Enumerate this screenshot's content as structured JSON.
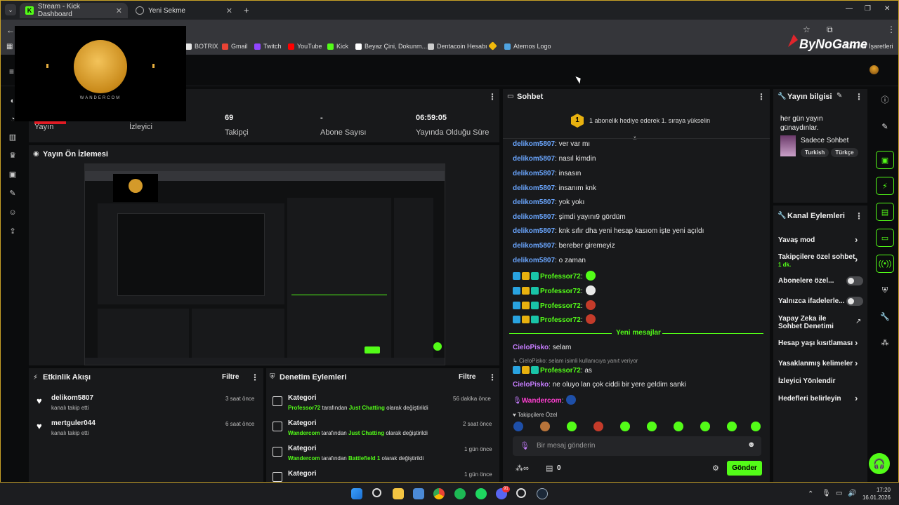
{
  "browser": {
    "tabs": [
      {
        "label": "Stream - Kick Dashboard",
        "active": true
      },
      {
        "label": "Yeni Sekme",
        "active": false
      }
    ],
    "new_tab_symbol": "+",
    "bookmarks": [
      {
        "label": "BOTRIX",
        "color": "#e6e6e6"
      },
      {
        "label": "Gmail",
        "color": "#ea4335"
      },
      {
        "label": "Twitch",
        "color": "#9146ff"
      },
      {
        "label": "YouTube",
        "color": "#ff0000"
      },
      {
        "label": "Kick",
        "color": "#53fc18"
      },
      {
        "label": "Beyaz Çini, Dokunm...",
        "color": "#ffffff"
      },
      {
        "label": "Dentacoin Hesabı",
        "color": "#cccccc"
      },
      {
        "label": "",
        "color": "#f0b90b"
      },
      {
        "label": "Aternos Logo",
        "color": "#4fa3e0"
      }
    ],
    "all_bookmarks": "Tüm Yer İşaretleri",
    "overlay_logo": "ByNoGame",
    "webcam_caption": "WANDERCOM"
  },
  "stats": [
    {
      "value": "",
      "label": "Yayın"
    },
    {
      "value": "",
      "label": "İzleyici"
    },
    {
      "value": "69",
      "label": "Takipçi"
    },
    {
      "value": "-",
      "label": "Abone Sayısı"
    },
    {
      "value": "06:59:05",
      "label": "Yayında Olduğu Süre"
    }
  ],
  "preview": {
    "title": "Yayın Ön İzlemesi"
  },
  "activity": {
    "title": "Etkinlik Akışı",
    "filter": "Filtre",
    "items": [
      {
        "user": "delikom5807",
        "action": "kanalı takip etti",
        "time": "3 saat önce"
      },
      {
        "user": "mertguler044",
        "action": "kanalı takip etti",
        "time": "6 saat önce"
      }
    ]
  },
  "moderation": {
    "title": "Denetim Eylemleri",
    "filter": "Filtre",
    "items": [
      {
        "title": "Kategori",
        "user": "Professor72",
        "mid": " tarafından ",
        "target": "Just Chatting",
        "tail": " olarak değiştirildi",
        "time": "56 dakika önce"
      },
      {
        "title": "Kategori",
        "user": "Wandercom",
        "mid": " tarafından ",
        "target": "Just Chatting",
        "tail": " olarak değiştirildi",
        "time": "2 saat önce"
      },
      {
        "title": "Kategori",
        "user": "Wandercom",
        "mid": " tarafından ",
        "target": "Battlefield 1",
        "tail": " olarak değiştirildi",
        "time": "1 gün önce"
      },
      {
        "title": "Kategori",
        "user": "",
        "mid": "",
        "target": "",
        "tail": "",
        "time": "1 gün önce"
      }
    ]
  },
  "chat": {
    "title": "Sohbet",
    "banner": "1 abonelik hediye ederek 1. sıraya yükselin",
    "banner_rank": "1",
    "messages": [
      {
        "user": "delikom5807",
        "text": ": yer var mı"
      },
      {
        "user": "delikom5807",
        "text": ": nasıl kimdin"
      },
      {
        "user": "delikom5807",
        "text": ": insasın"
      },
      {
        "user": "delikom5807",
        "text": ": insanım knk"
      },
      {
        "user": "delikom5807",
        "text": ": yok yokı"
      },
      {
        "user": "delikom5807",
        "text": ": şimdi yayını9 gördüm"
      },
      {
        "user": "delikom5807",
        "text": ": knk sıfır dha yeni hesap kasıom işte yeni açıldı"
      },
      {
        "user": "delikom5807",
        "text": ": bereber giremeyiz"
      },
      {
        "user": "delikom5807",
        "text": ": o zaman"
      },
      {
        "user": "Professor72",
        "text": ":"
      },
      {
        "user": "Professor72",
        "text": ":"
      },
      {
        "user": "Professor72",
        "text": ":"
      },
      {
        "user": "Professor72",
        "text": ":"
      }
    ],
    "new_messages": "Yeni mesajlar",
    "after": [
      {
        "user": "CieloPisko",
        "text": ": selam"
      },
      {
        "reply": "CieloPisko: selam isimli kullanıcıya yanıt veriyor",
        "user": "Professor72",
        "text": ": as"
      },
      {
        "user": "CieloPisko",
        "text": ": ne oluyo lan çok ciddi bir yere geldim sanki"
      },
      {
        "user": "Wandercom",
        "text": ":"
      }
    ],
    "followers_only": "Takipçilere Özel",
    "input_placeholder": "Bir mesaj gönderin",
    "points": "0",
    "send": "Gönder"
  },
  "stream_info": {
    "title": "Yayın bilgisi",
    "description": "her gün yayın günaydınlar.",
    "category": "Sadece Sohbet",
    "tags": [
      "Turkish",
      "Türkçe"
    ]
  },
  "channel_actions": {
    "title": "Kanal Eylemleri",
    "items": [
      {
        "label": "Yavaş mod",
        "kind": "chevron"
      },
      {
        "label": "Takipçilere özel sohbet",
        "sub": "1 dk.",
        "kind": "chevron"
      },
      {
        "label": "Abonelere özel...",
        "kind": "toggle"
      },
      {
        "label": "Yalnızca ifadelerle...",
        "kind": "toggle"
      },
      {
        "label": "Yapay Zeka ile Sohbet Denetimi",
        "kind": "link"
      },
      {
        "label": "Hesap yaşı kısıtlaması",
        "kind": "chevron"
      },
      {
        "label": "Yasaklanmış kelimeler",
        "kind": "chevron"
      },
      {
        "label": "İzleyici Yönlendir",
        "kind": "none"
      },
      {
        "label": "Hedefleri belirleyin",
        "kind": "chevron"
      }
    ]
  },
  "taskbar": {
    "time": "17:20",
    "date": "16.01.2026",
    "badge": "91"
  }
}
